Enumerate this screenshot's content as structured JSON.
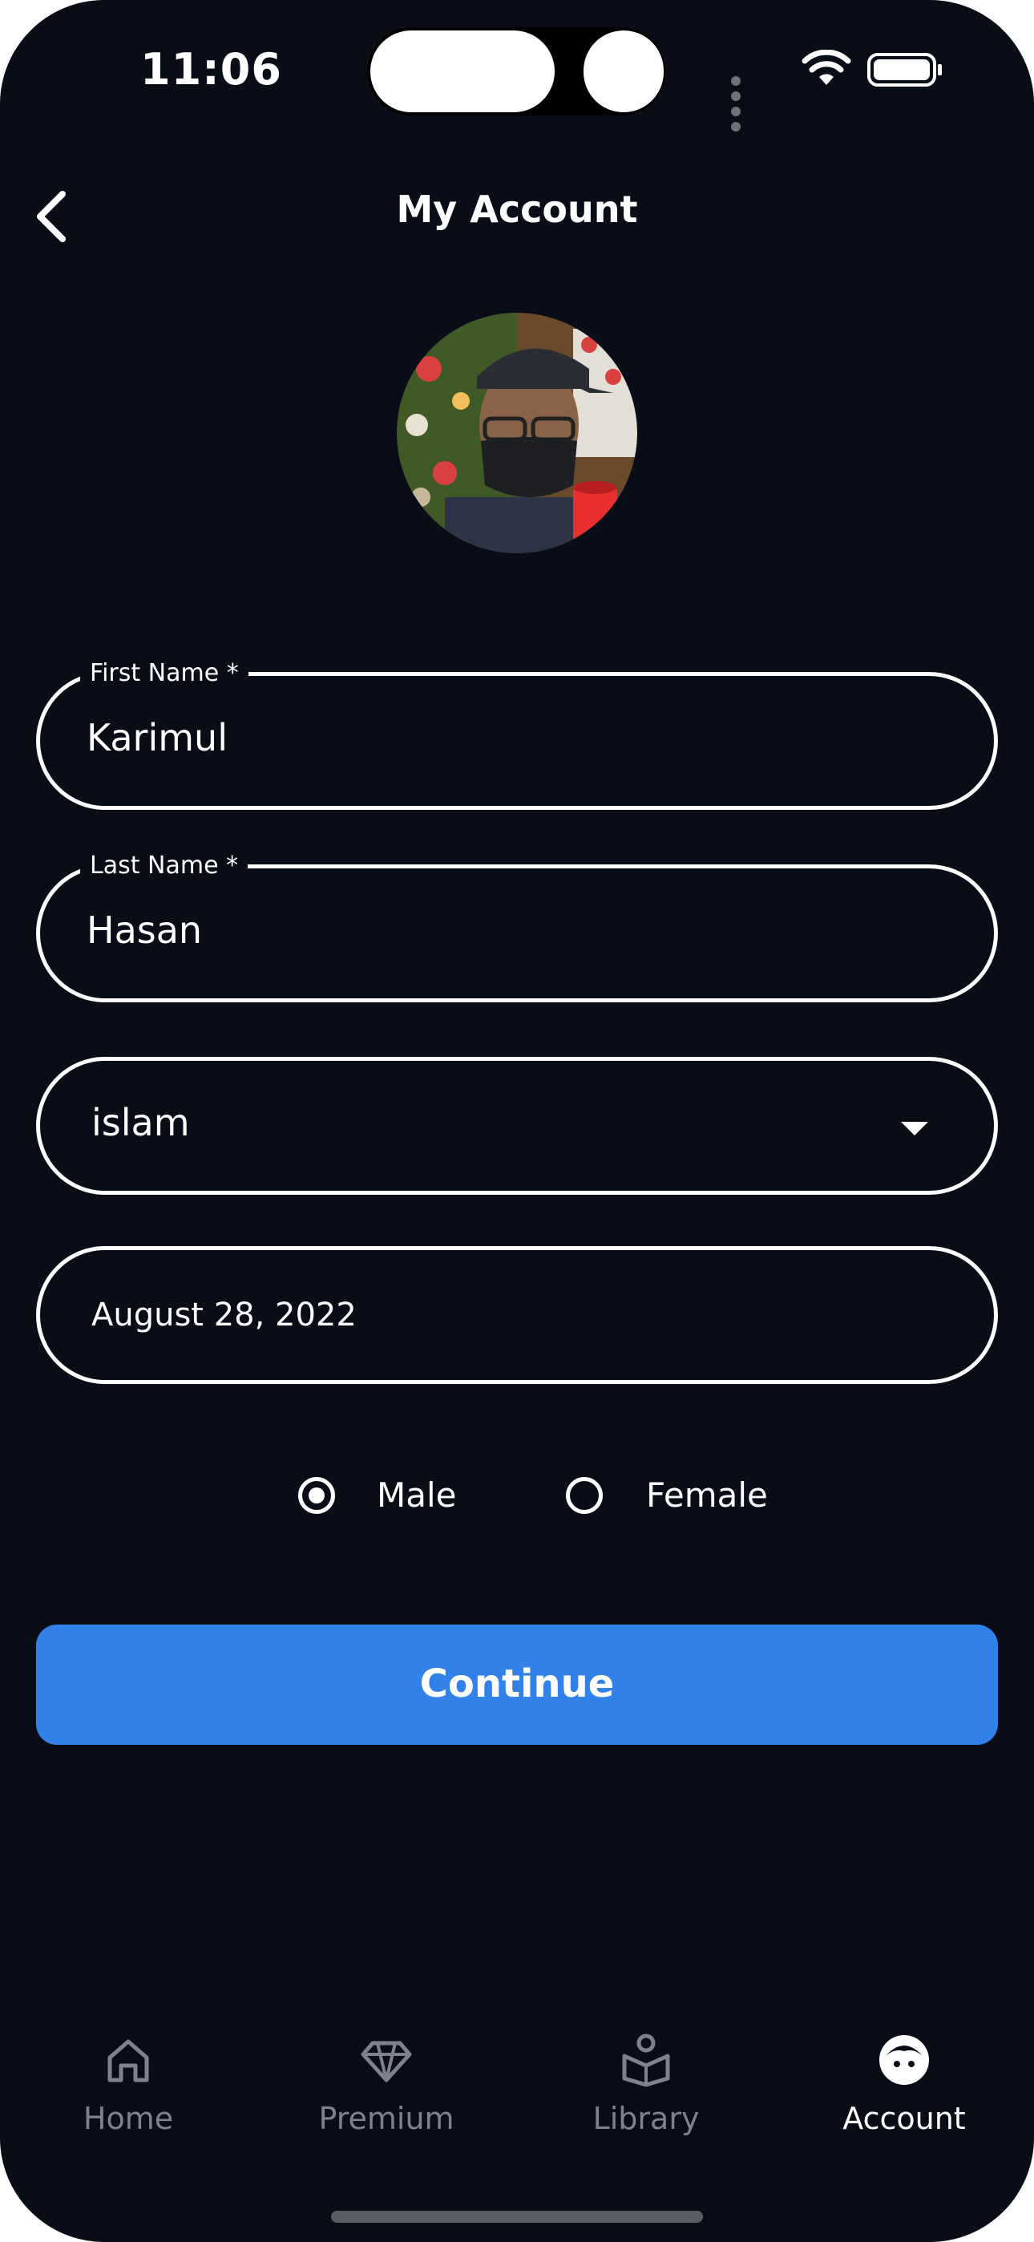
{
  "status_bar": {
    "time": "11:06"
  },
  "header": {
    "title": "My Account"
  },
  "form": {
    "first_name": {
      "label": "First Name *",
      "value": "Karimul"
    },
    "last_name": {
      "label": "Last Name *",
      "value": "Hasan"
    },
    "religion": {
      "value": "islam"
    },
    "birth_date": {
      "value": "August 28, 2022"
    },
    "gender": {
      "options": [
        {
          "label": "Male",
          "selected": true
        },
        {
          "label": "Female",
          "selected": false
        }
      ]
    },
    "continue_label": "Continue"
  },
  "tabs": [
    {
      "label": "Home",
      "icon": "home-icon",
      "active": false
    },
    {
      "label": "Premium",
      "icon": "diamond-icon",
      "active": false
    },
    {
      "label": "Library",
      "icon": "library-icon",
      "active": false
    },
    {
      "label": "Account",
      "icon": "account-face-icon",
      "active": true
    }
  ],
  "colors": {
    "background": "#080d18",
    "accent": "#3181e8",
    "inactive_tab": "#7d828c",
    "badge": "#e83030"
  }
}
